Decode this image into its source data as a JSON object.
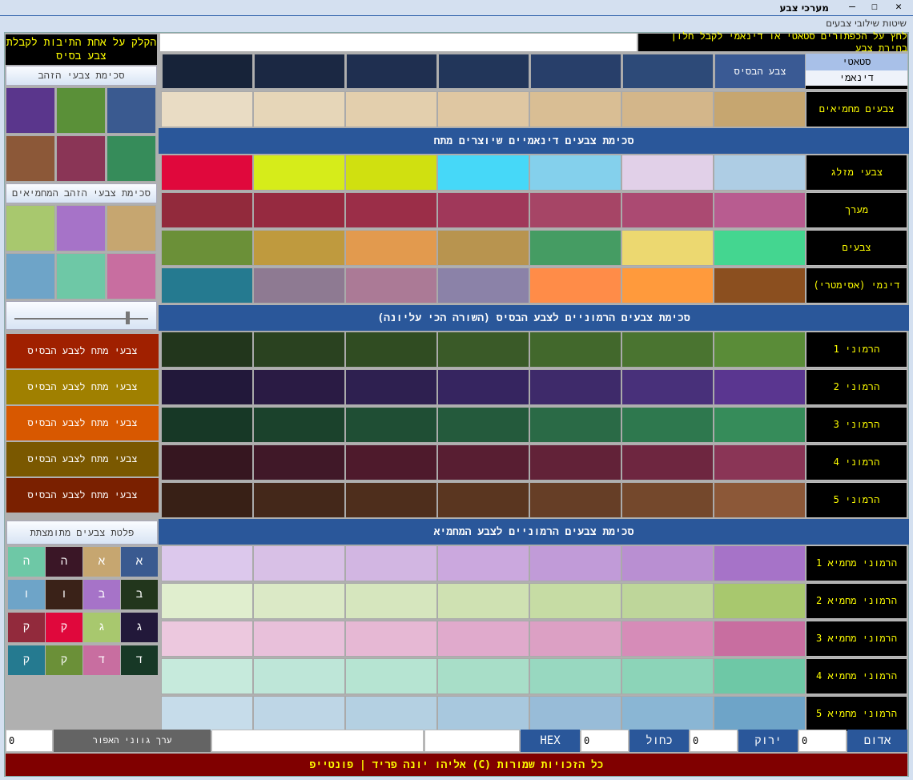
{
  "window": {
    "title": "מערכי צבע",
    "close": "✕",
    "maximize": "☐",
    "minimize": "–"
  },
  "menu": {
    "item": "שיטות שילובי צבעים"
  },
  "left": {
    "instruction": "הקלק על אחת התיבות לקבלת צבע בסיס",
    "golden_label": "סכימת צבעי הזהב",
    "golden_colors": [
      "#3a5a90",
      "#5a9038",
      "#5a368c",
      "#368c5a",
      "#8a3556",
      "#8c5838"
    ],
    "golden_comp_label": "סכימת צבעי הזהב המחמיאים",
    "golden_comp_colors": [
      "#c6a670",
      "#a673c8",
      "#a8c86e",
      "#c86ea0",
      "#6ec8a6",
      "#6ea4c8"
    ],
    "slider_value": 0.85,
    "tension_buttons": [
      {
        "label": "צבעי מתח לצבע הבסיס",
        "color": "#a02000"
      },
      {
        "label": "צבעי מתח לצבע הבסיס",
        "color": "#a08000"
      },
      {
        "label": "צבעי מתח לצבע הבסיס",
        "color": "#d85800"
      },
      {
        "label": "צבעי מתח לצבע הבסיס",
        "color": "#7a5800"
      },
      {
        "label": "צבעי מתח לצבע הבסיס",
        "color": "#7a2000"
      }
    ],
    "palette_label": "פלטת  צבעים מתומצתת",
    "palette": [
      [
        {
          "t": "א",
          "c": "#3a5a90"
        },
        {
          "t": "א",
          "c": "#c6a670"
        },
        {
          "t": "ה",
          "c": "#3a1626"
        },
        {
          "t": "ה",
          "c": "#6ec8a6"
        }
      ],
      [
        {
          "t": "ב",
          "c": "#22361c"
        },
        {
          "t": "ב",
          "c": "#a673c8"
        },
        {
          "t": "ו",
          "c": "#3a2218"
        },
        {
          "t": "ו",
          "c": "#6ea4c8"
        }
      ],
      [
        {
          "t": "ג",
          "c": "#22183a"
        },
        {
          "t": "ג",
          "c": "#a8c86e"
        },
        {
          "t": "ק",
          "c": "#e0083c"
        },
        {
          "t": "ק",
          "c": "#922a3c"
        }
      ],
      [
        {
          "t": "ד",
          "c": "#173826"
        },
        {
          "t": "ד",
          "c": "#c86ea0"
        },
        {
          "t": "ק",
          "c": "#6b9038"
        },
        {
          "t": "ק",
          "c": "#257a90"
        }
      ]
    ]
  },
  "top": {
    "instruction": "לחץ על הכפתורים סטאטי או דינאמי לקבל חלון בחירת צבע",
    "mode_static": "סטאטי",
    "mode_dynamic": "דינאמי",
    "base_label": "צבע הבסיס",
    "base_row": [
      "#3a5a94",
      "#2d4a78",
      "#283f6a",
      "#22365a",
      "#1f2f50",
      "#1b2843",
      "#172339"
    ]
  },
  "sections": [
    {
      "rows": [
        {
          "label": "צבעים מחמיאים",
          "colors": [
            "#c6a670",
            "#d3b68a",
            "#d9be94",
            "#dfc7a2",
            "#e3cfad",
            "#e6d6b8",
            "#e9dcc4"
          ]
        }
      ]
    },
    {
      "title": "סכימת צבעים דינאמיים שיוצרים מתח",
      "rows": [
        {
          "label": "צבעי מזלג",
          "colors": [
            "#aecde4",
            "#e1d0e8",
            "#84d0ec",
            "#46d8f8",
            "#d0e010",
            "#d6ec1a",
            "#e0083c"
          ]
        },
        {
          "label": "מערך",
          "colors": [
            "#b85c90",
            "#ab4a72",
            "#a64566",
            "#a0385a",
            "#9b2e48",
            "#962a40",
            "#922a3c"
          ]
        },
        {
          "label": "צבעים",
          "colors": [
            "#44d690",
            "#ecd870",
            "#459c63",
            "#b8944f",
            "#e29a4e",
            "#bf9a3e",
            "#6b9038"
          ]
        },
        {
          "label": "דינמי (אסימטרי)",
          "colors": [
            "#8b4f1f",
            "#ff9a3c",
            "#ff8c48",
            "#8b82a8",
            "#ab7a96",
            "#8e7a92",
            "#257a90"
          ]
        }
      ]
    },
    {
      "title": "סכימת צבעים הרמוניים לצבע הבסיס (השורה הכי עליונה)",
      "rows": [
        {
          "label": "הרמוני 1",
          "colors": [
            "#5a8c38",
            "#4a7430",
            "#42682c",
            "#3a5a28",
            "#304c22",
            "#2a4220",
            "#22361c"
          ]
        },
        {
          "label": "הרמוני 2",
          "colors": [
            "#5a3690",
            "#48307a",
            "#3e2a6a",
            "#362560",
            "#2e2050",
            "#2a1b44",
            "#22183a"
          ]
        },
        {
          "label": "הרמוני 3",
          "colors": [
            "#368c5a",
            "#2e784e",
            "#2a6a46",
            "#245a3c",
            "#1f4e34",
            "#1b422c",
            "#173826"
          ]
        },
        {
          "label": "הרמוני 4",
          "colors": [
            "#8a3556",
            "#6e2640",
            "#622238",
            "#581e32",
            "#4e1a2c",
            "#401828",
            "#361620"
          ]
        },
        {
          "label": "הרמוני 5",
          "colors": [
            "#8c5838",
            "#74482c",
            "#663e26",
            "#5a3620",
            "#4e2e1c",
            "#44281a",
            "#382016"
          ]
        }
      ]
    },
    {
      "title": "סכימת צבעים הרמוניים לצבע המחמיא",
      "rows": [
        {
          "label": "הרמוני מחמיא 1",
          "colors": [
            "#a673c8",
            "#b98fd2",
            "#c19bd8",
            "#cba8de",
            "#d2b6e2",
            "#d8c0e6",
            "#dcc8ec"
          ]
        },
        {
          "label": "הרמוני מחמיא 2",
          "colors": [
            "#a8c86e",
            "#bed69a",
            "#c6dca4",
            "#cfe1b2",
            "#d6e6be",
            "#dbe9c6",
            "#e0eece"
          ]
        },
        {
          "label": "הרמוני מחמיא 3",
          "colors": [
            "#c86ea0",
            "#d68cb8",
            "#dca0c4",
            "#e0aacc",
            "#e6b8d4",
            "#e8c0da",
            "#ecc8de"
          ]
        },
        {
          "label": "הרמוני מחמיא 4",
          "colors": [
            "#6ec8a6",
            "#8cd4b8",
            "#98d8c0",
            "#a8dec8",
            "#b6e4d2",
            "#bee6d8",
            "#c6eadc"
          ]
        },
        {
          "label": "הרמוני מחמיא 5",
          "colors": [
            "#6ea4c8",
            "#8ab6d4",
            "#98bcd8",
            "#a8c8de",
            "#b4d0e2",
            "#bed6e6",
            "#c6dcea"
          ]
        }
      ]
    }
  ],
  "bottom": {
    "red_label": "אדום",
    "red": "0",
    "green_label": "ירוק",
    "green": "0",
    "blue_label": "כחול",
    "blue": "0",
    "hex_label": "HEX",
    "hex": "",
    "gray_label": "ערך גווני האפור",
    "gray": "0"
  },
  "footer": {
    "text": "כל הזכויות שמורות (C) אליהו יונה פריד | פונטייפ"
  }
}
